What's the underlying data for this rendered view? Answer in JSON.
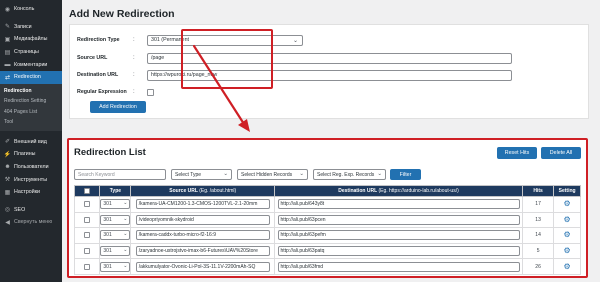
{
  "sidebar": {
    "items": [
      {
        "label": "Консоль",
        "icon": "dashboard-icon"
      },
      {
        "label": "Записи",
        "icon": "pin-icon"
      },
      {
        "label": "Медиафайлы",
        "icon": "media-icon"
      },
      {
        "label": "Страницы",
        "icon": "page-icon"
      },
      {
        "label": "Комментарии",
        "icon": "comment-icon"
      },
      {
        "label": "Redirection",
        "icon": "redirect-icon"
      }
    ],
    "submenu": [
      "Redirection",
      "Redirection Setting",
      "404 Pages List",
      "Tool"
    ],
    "items2": [
      {
        "label": "Внешний вид",
        "icon": "brush-icon"
      },
      {
        "label": "Плагины",
        "icon": "plugin-icon"
      },
      {
        "label": "Пользователи",
        "icon": "users-icon"
      },
      {
        "label": "Инструменты",
        "icon": "wrench-icon"
      },
      {
        "label": "Настройки",
        "icon": "settings-icon"
      }
    ],
    "items3": [
      {
        "label": "SEO",
        "icon": "seo-icon"
      },
      {
        "label": "Свернуть меню",
        "icon": "collapse-icon"
      }
    ]
  },
  "page": {
    "title": "Add New Redirection"
  },
  "form": {
    "type_label": "Redirection Type",
    "type_value": "301 (Permanent",
    "source_label": "Source URL",
    "source_value": "/page",
    "dest_label": "Destination URL",
    "dest_value": "https://wpuroki.ru/page_new",
    "regex_label": "Regular Expression",
    "colon": ":",
    "add_button": "Add Redirection"
  },
  "list": {
    "title": "Redirection List",
    "reset_hits": "Reset Hits",
    "delete_all": "Delete All",
    "search_placeholder": "Search Keyword",
    "select_type": "Select Type",
    "select_hidden": "Select Hidden Records",
    "select_regexp": "Select Reg. Exp. Records",
    "filter_button": "Filter",
    "columns": {
      "type": "Type",
      "source": "Source URL",
      "source_hint": "(Eg. /about.html)",
      "dest": "Destination URL",
      "dest_hint": "(Eg. https://arduino-lab.ru/about-us/)",
      "hits": "Hits",
      "setting": "Setting"
    },
    "rows": [
      {
        "type": "301",
        "source": "/kamera-UA-CM1200-1.3-CMOS-1200TVL-2.1-20mm",
        "dest": "http://ali.pub/643y8t",
        "hits": "17"
      },
      {
        "type": "301",
        "source": "/videopriyomnik-skydroid",
        "dest": "http://ali.pub/63pcen",
        "hits": "13"
      },
      {
        "type": "301",
        "source": "/kamera-caddx-turbo-micro-f2-16:9",
        "dest": "http://ali.pub/63pefm",
        "hits": "14"
      },
      {
        "type": "301",
        "source": "/zaryadnoe-ustrojstvo-imax-b6-Futures\\UAV%20Store",
        "dest": "http://ali.pub/63patq",
        "hits": "5"
      },
      {
        "type": "301",
        "source": "/akkumulyator-Ovonic-Li-Pol-3S-11.1V-2200mAh-SQ",
        "dest": "http://ali.pub/63fmd",
        "hits": "26"
      }
    ]
  },
  "colors": {
    "sidebar_bg": "#23282d",
    "accent": "#2271b1",
    "header_bg": "#1e3a5f",
    "annotation": "#cf1f25"
  }
}
